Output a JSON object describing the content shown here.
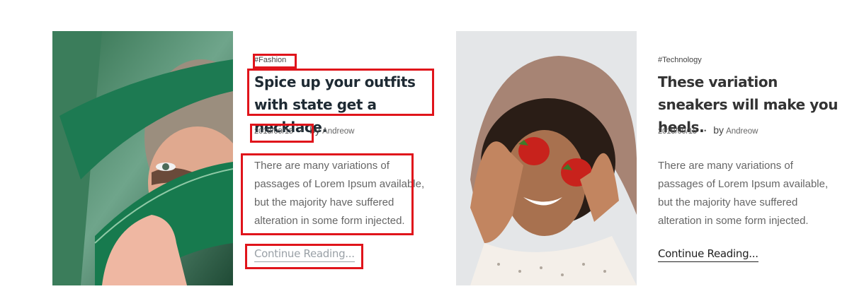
{
  "posts": [
    {
      "category": "#Fashion",
      "title": "Spice up your outfits with state get a necklace.",
      "date": "2018/09/15",
      "dot": "•",
      "by": "by",
      "author": "Andreow",
      "excerpt": "There are many variations of passages of Lorem Ipsum available, but the majority have suffered alteration in some form injected.",
      "cta": "Continue Reading...",
      "image": "woman-with-leaf-photo"
    },
    {
      "category": "#Technology",
      "title": "These variation sneakers will make you heels.",
      "date": "2018/09/15",
      "dot": "•",
      "by": "by",
      "author": "Andreow",
      "excerpt": "There are many variations of passages of Lorem Ipsum available, but the majority have suffered alteration in some form injected.",
      "cta": "Continue Reading...",
      "image": "woman-with-strawberries-photo"
    }
  ],
  "colors": {
    "highlight": "#e0141b",
    "title": "#1e2a33",
    "text": "#666666"
  }
}
